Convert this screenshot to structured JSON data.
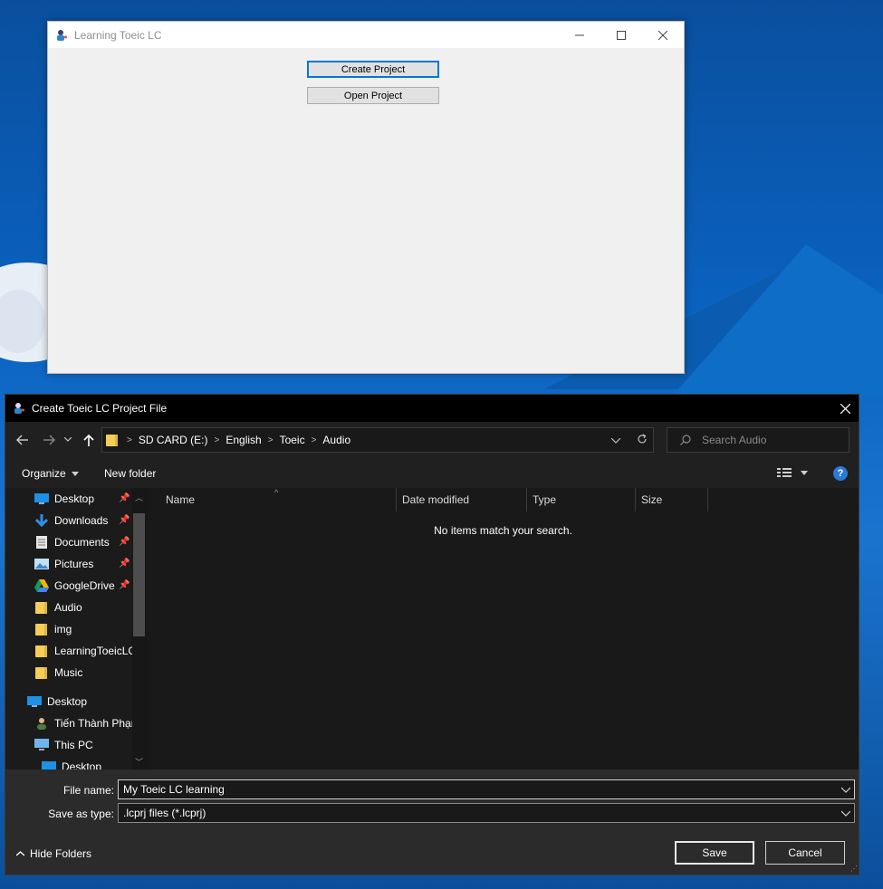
{
  "app_window": {
    "title": "Learning Toeic LC",
    "buttons": {
      "create": "Create Project",
      "open": "Open Project"
    }
  },
  "dialog": {
    "title": "Create Toeic LC Project File",
    "breadcrumbs": [
      "SD CARD (E:)",
      "English",
      "Toeic",
      "Audio"
    ],
    "search_placeholder": "Search Audio",
    "toolbar": {
      "organize": "Organize",
      "new_folder": "New folder"
    },
    "nav_items": [
      {
        "label": "Desktop",
        "icon": "desktop-icon",
        "pinned": true
      },
      {
        "label": "Downloads",
        "icon": "download-icon",
        "pinned": true
      },
      {
        "label": "Documents",
        "icon": "document-icon",
        "pinned": true
      },
      {
        "label": "Pictures",
        "icon": "pictures-icon",
        "pinned": true
      },
      {
        "label": "GoogleDrive",
        "icon": "google-drive-icon",
        "pinned": true
      },
      {
        "label": "Audio",
        "icon": "folder-icon",
        "pinned": false
      },
      {
        "label": "img",
        "icon": "folder-icon",
        "pinned": false
      },
      {
        "label": "LearningToeicLC",
        "icon": "folder-icon",
        "pinned": false
      },
      {
        "label": "Music",
        "icon": "folder-icon",
        "pinned": false
      }
    ],
    "nav_tree": [
      {
        "label": "Desktop",
        "icon": "desktop-icon"
      },
      {
        "label": "Tiến Thành Phạm",
        "icon": "user-icon"
      },
      {
        "label": "This PC",
        "icon": "computer-icon"
      },
      {
        "label": "Desktop",
        "icon": "desktop-icon"
      }
    ],
    "columns": [
      "Name",
      "Date modified",
      "Type",
      "Size"
    ],
    "empty_message": "No items match your search.",
    "file_name_label": "File name:",
    "file_name_value": "My Toeic LC learning",
    "save_type_label": "Save as type:",
    "save_type_value": ".lcprj files (*.lcprj)",
    "hide_folders": "Hide Folders",
    "save": "Save",
    "cancel": "Cancel"
  },
  "colors": {
    "accent": "#0078d7",
    "dialog_bg": "#202020",
    "folder": "#f5cd57"
  }
}
